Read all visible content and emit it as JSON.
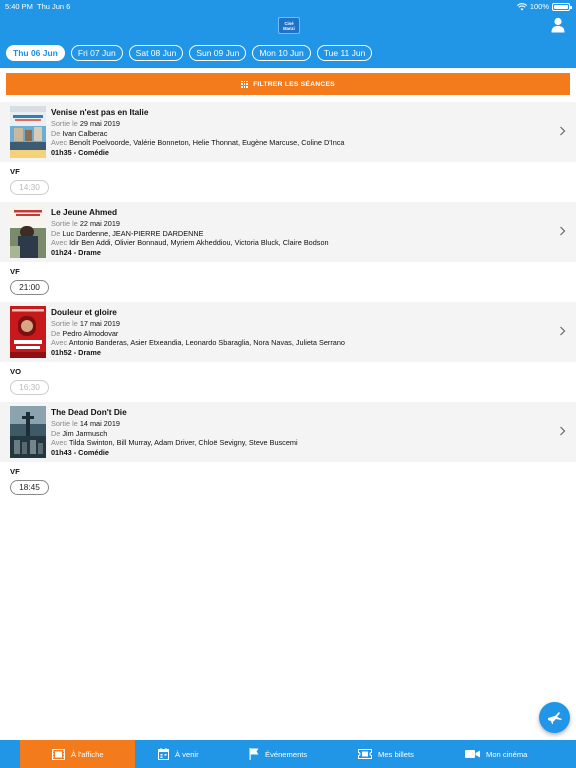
{
  "status_bar": {
    "time": "5:40 PM",
    "date": "Thu Jun 6",
    "battery": "100%"
  },
  "header": {
    "logo_text_1": "Ciné",
    "logo_text_2": "Manzi"
  },
  "days": [
    "Thu 06 Jun",
    "Fri 07 Jun",
    "Sat 08 Jun",
    "Sun 09 Jun",
    "Mon 10 Jun",
    "Tue 11 Jun"
  ],
  "filter": {
    "label": "FILTRER LES SÉANCES"
  },
  "labels": {
    "release": "Sortie le",
    "director": "De",
    "cast": "Avec"
  },
  "movies": [
    {
      "title": "Venise n'est pas en Italie",
      "release": "29 mai 2019",
      "director": "Ivan Calberac",
      "cast": "Benoît Poelvoorde, Valérie Bonneton, Helie Thonnat, Eugène Marcuse, Coline D'Inca",
      "duration_genre": "01h35 - Comédie",
      "version": "VF",
      "showtime": "14:30",
      "showtime_past": true
    },
    {
      "title": "Le Jeune Ahmed",
      "release": "22 mai 2019",
      "director": "Luc Dardenne, JEAN-PIERRE DARDENNE",
      "cast": "Idir Ben Addi, Olivier Bonnaud, Myriem Akheddiou, Victoria Bluck, Claire Bodson",
      "duration_genre": "01h24 - Drame",
      "version": "VF",
      "showtime": "21:00",
      "showtime_past": false
    },
    {
      "title": "Douleur et gloire",
      "release": "17 mai 2019",
      "director": "Pedro Almodovar",
      "cast": "Antonio Banderas, Asier Etxeandia, Leonardo Sbaraglia, Nora Navas, Julieta Serrano",
      "duration_genre": "01h52 - Drame",
      "version": "VO",
      "showtime": "16:30",
      "showtime_past": true
    },
    {
      "title": "The Dead Don't Die",
      "release": "14 mai 2019",
      "director": "Jim Jarmusch",
      "cast": "Tilda Swinton, Bill Murray, Adam Driver, Chloë Sevigny, Steve Buscemi",
      "duration_genre": "01h43 - Comédie",
      "version": "VF",
      "showtime": "18:45",
      "showtime_past": false
    }
  ],
  "tabs": [
    {
      "label": "À l'affiche",
      "icon": "film-icon",
      "active": true
    },
    {
      "label": "À venir",
      "icon": "calendar-icon",
      "active": false
    },
    {
      "label": "Événements",
      "icon": "flag-icon",
      "active": false
    },
    {
      "label": "Mes billets",
      "icon": "ticket-icon",
      "active": false
    },
    {
      "label": "Mon cinéma",
      "icon": "cinema-camera-icon",
      "active": false
    }
  ],
  "colors": {
    "primary": "#2196e6",
    "accent": "#f47b1c",
    "row_bg": "#f4f4f4"
  }
}
